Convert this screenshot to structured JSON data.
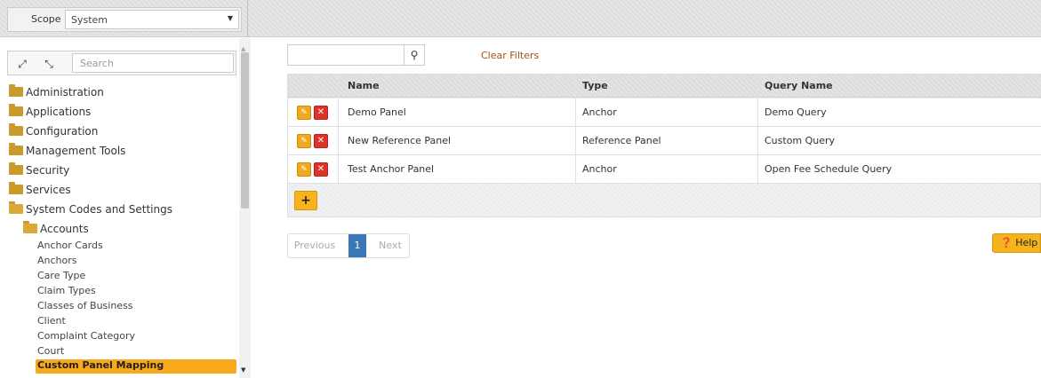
{
  "topbar": {
    "scope_label": "Scope",
    "scope_value": "System"
  },
  "sidebar": {
    "search_placeholder": "Search",
    "folders": [
      {
        "label": "Administration"
      },
      {
        "label": "Applications"
      },
      {
        "label": "Configuration"
      },
      {
        "label": "Management Tools"
      },
      {
        "label": "Security"
      },
      {
        "label": "Services"
      },
      {
        "label": "System Codes and Settings"
      }
    ],
    "subfolder": {
      "label": "Accounts"
    },
    "items": [
      {
        "label": "Anchor Cards"
      },
      {
        "label": "Anchors"
      },
      {
        "label": "Care Type"
      },
      {
        "label": "Claim Types"
      },
      {
        "label": "Classes of Business"
      },
      {
        "label": "Client"
      },
      {
        "label": "Complaint Category"
      },
      {
        "label": "Court"
      },
      {
        "label": "Custom Panel Mapping"
      }
    ]
  },
  "filters": {
    "clear_label": "Clear Filters"
  },
  "grid": {
    "columns": [
      "Name",
      "Type",
      "Query Name"
    ],
    "rows": [
      {
        "name": "Demo Panel",
        "type": "Anchor",
        "query": "Demo Query"
      },
      {
        "name": "New Reference Panel",
        "type": "Reference Panel",
        "query": "Custom Query"
      },
      {
        "name": "Test Anchor Panel",
        "type": "Anchor",
        "query": "Open Fee Schedule Query"
      }
    ],
    "add_label": "+"
  },
  "pager": {
    "previous": "Previous",
    "page": "1",
    "next": "Next"
  },
  "help_label": "Help",
  "colors": {
    "accent": "#f5b31c",
    "delete": "#e0302a",
    "active_page": "#3a78b5",
    "link": "#a0521a",
    "folder": "#c99a2c"
  }
}
